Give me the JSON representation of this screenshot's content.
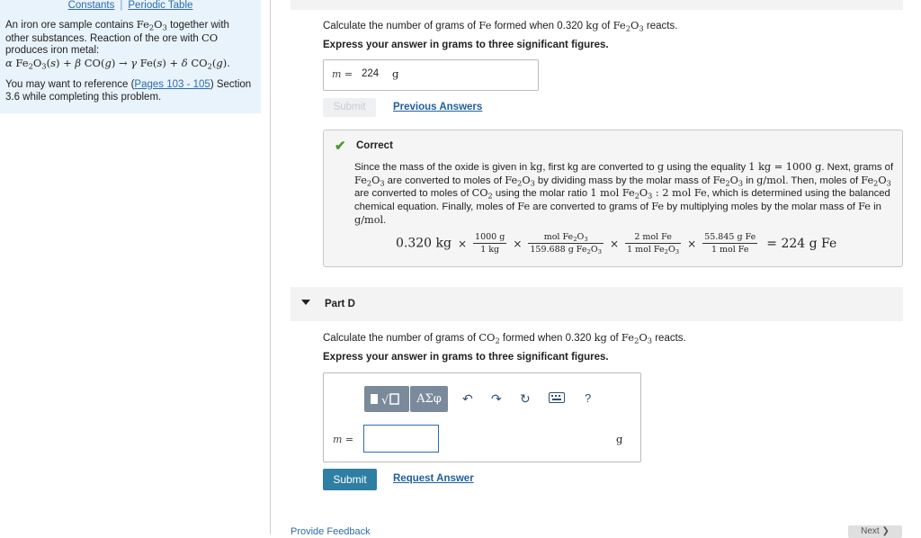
{
  "links": {
    "constants": "Constants",
    "sep": "|",
    "periodic": "Periodic Table"
  },
  "intro": {
    "p1a": "An iron ore sample contains ",
    "p1b": " together with other substances. Reaction of the ore with ",
    "p1c": " produces iron metal:",
    "ref_pre": "You may want to reference (",
    "ref_link": "Pages 103 - 105",
    "ref_post": ") Section 3.6 while completing this problem."
  },
  "partc": {
    "q_pre": "Calculate the number of grams of ",
    "q_mid": " formed when 0.320 ",
    "q_mid2": " of ",
    "q_post": " reacts.",
    "instr": "Express your answer in grams to three significant figures.",
    "label": "m =",
    "value": "224",
    "unit": "g",
    "submit": "Submit",
    "prev": "Previous Answers"
  },
  "correct": {
    "title": "Correct",
    "s1": "Since the mass of the oxide is given in ",
    "s2": ", first kg are converted to ",
    "s3": " using the equality ",
    "s4": ". Next, grams of ",
    "s5": " are converted to moles of ",
    "s6": " by dividing mass by the molar mass of ",
    "s7": " in ",
    "s8": ". Then, moles of ",
    "s9": " are converted to moles of ",
    "s10": " using the molar ratio ",
    "s11": ", which is determined using the balanced chemical equation. Finally, moles of ",
    "s12": " are converted to grams of ",
    "s13": " by multiplying moles by the molar mass of ",
    "s14": " in ",
    "eq_start": "0.320 kg",
    "f1n": "1000 g",
    "f1d": "1 kg",
    "f2n": "mol Fe",
    "f2d": "159.688 g Fe",
    "f3n": "2 mol Fe",
    "f3d": "1 mol Fe",
    "f4n": "55.845 g Fe",
    "f4d": "1 mol Fe",
    "eq_end": "= 224 g Fe"
  },
  "partd": {
    "title": "Part D",
    "q_pre": "Calculate the number of grams of ",
    "q_mid": " formed when 0.320 ",
    "q_mid2": " of ",
    "q_post": " reacts.",
    "instr": "Express your answer in grams to three significant figures.",
    "tool2": "ΑΣφ",
    "help": "?",
    "label": "m =",
    "unit": "g",
    "submit": "Submit",
    "request": "Request Answer"
  },
  "footer": {
    "feedback": "Provide Feedback",
    "next": "Next ❯"
  },
  "colors": {
    "accent": "#2f7ea3",
    "link": "#2d6ca9",
    "check": "#4a9a2e"
  }
}
